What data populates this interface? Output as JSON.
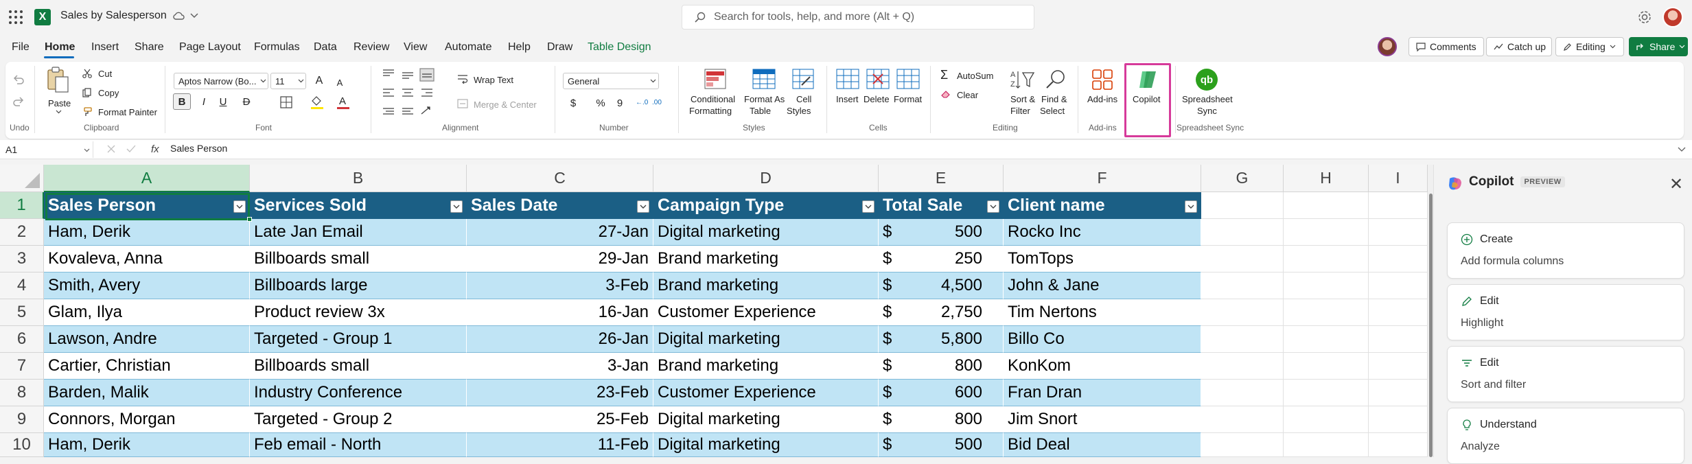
{
  "titlebar": {
    "app_letter": "X",
    "doc_title": "Sales by Salesperson",
    "search_placeholder": "Search for tools, help, and more (Alt + Q)"
  },
  "menu": {
    "tabs": [
      "File",
      "Home",
      "Insert",
      "Share",
      "Page Layout",
      "Formulas",
      "Data",
      "Review",
      "View",
      "Automate",
      "Help",
      "Draw",
      "Table Design"
    ],
    "active_tab": "Home",
    "comments": "Comments",
    "catch_up": "Catch up",
    "editing": "Editing",
    "share": "Share"
  },
  "ribbon": {
    "undo_label": "Undo",
    "clipboard": {
      "paste": "Paste",
      "cut": "Cut",
      "copy": "Copy",
      "format_painter": "Format Painter",
      "group": "Clipboard"
    },
    "font": {
      "family": "Aptos Narrow (Bo...",
      "size": "11",
      "grow": "A",
      "shrink": "A",
      "bold": "B",
      "italic": "I",
      "underline": "U",
      "strike": "D",
      "color_letter": "A",
      "group": "Font"
    },
    "alignment": {
      "wrap": "Wrap Text",
      "merge": "Merge & Center",
      "group": "Alignment"
    },
    "number": {
      "format": "General",
      "currency": "$",
      "percent": "%",
      "comma": "9",
      "group": "Number"
    },
    "styles": {
      "conditional_1": "Conditional",
      "conditional_2": "Formatting",
      "format_table_1": "Format As",
      "format_table_2": "Table",
      "cell_styles_1": "Cell",
      "cell_styles_2": "Styles",
      "group": "Styles"
    },
    "cells": {
      "insert": "Insert",
      "delete": "Delete",
      "format": "Format",
      "group": "Cells"
    },
    "editing": {
      "autosum": "AutoSum",
      "clear": "Clear",
      "sort_1": "Sort &",
      "sort_2": "Filter",
      "find_1": "Find &",
      "find_2": "Select",
      "group": "Editing"
    },
    "addins": {
      "label": "Add-ins",
      "group": "Add-ins"
    },
    "copilot": {
      "label": "Copilot"
    },
    "sync": {
      "label_1": "Spreadsheet",
      "label_2": "Sync",
      "group": "Spreadsheet Sync",
      "logo": "qb"
    }
  },
  "formula_bar": {
    "name_box": "A1",
    "fx": "fx",
    "content": "Sales Person"
  },
  "grid": {
    "columns": [
      "A",
      "B",
      "C",
      "D",
      "E",
      "F",
      "G",
      "H",
      "I"
    ],
    "row_numbers": [
      "1",
      "2",
      "3",
      "4",
      "5",
      "6",
      "7",
      "8",
      "9",
      "10"
    ],
    "headers": [
      "Sales Person",
      "Services Sold",
      "Sales Date",
      "Campaign Type",
      "Total Sale",
      "Client name"
    ],
    "rows": [
      [
        "Ham, Derik",
        "Late Jan Email",
        "27-Jan",
        "Digital marketing",
        "$",
        "500",
        "Rocko Inc"
      ],
      [
        "Kovaleva, Anna",
        "Billboards small",
        "29-Jan",
        "Brand marketing",
        "$",
        "250",
        "TomTops"
      ],
      [
        "Smith, Avery",
        "Billboards large",
        "3-Feb",
        "Brand marketing",
        "$",
        "4,500",
        "John & Jane"
      ],
      [
        "Glam, Ilya",
        "Product review 3x",
        "16-Jan",
        "Customer Experience",
        "$",
        "2,750",
        "Tim Nertons"
      ],
      [
        "Lawson, Andre",
        "Targeted - Group 1",
        "26-Jan",
        "Digital marketing",
        "$",
        "5,800",
        "Billo Co"
      ],
      [
        "Cartier, Christian",
        "Billboards small",
        "3-Jan",
        "Brand marketing",
        "$",
        "800",
        "KonKom"
      ],
      [
        "Barden, Malik",
        "Industry Conference",
        "23-Feb",
        "Customer Experience",
        "$",
        "600",
        "Fran Dran"
      ],
      [
        "Connors, Morgan",
        "Targeted - Group 2",
        "25-Feb",
        "Digital marketing",
        "$",
        "800",
        "Jim Snort"
      ],
      [
        "Ham, Derik",
        "Feb email - North",
        "11-Feb",
        "Digital marketing",
        "$",
        "500",
        "Bid Deal"
      ]
    ]
  },
  "copilot": {
    "title": "Copilot",
    "badge": "PREVIEW",
    "close": "✕",
    "cards": [
      {
        "title": "Create",
        "subtitle": "Add formula columns"
      },
      {
        "title": "Edit",
        "subtitle": "Highlight"
      },
      {
        "title": "Edit",
        "subtitle": "Sort and filter"
      },
      {
        "title": "Understand",
        "subtitle": "Analyze"
      }
    ]
  },
  "colors": {
    "table_header": "#1b5f85",
    "band": "#c0e4f5",
    "excel_green": "#107c41",
    "highlight": "#d63a9a"
  }
}
